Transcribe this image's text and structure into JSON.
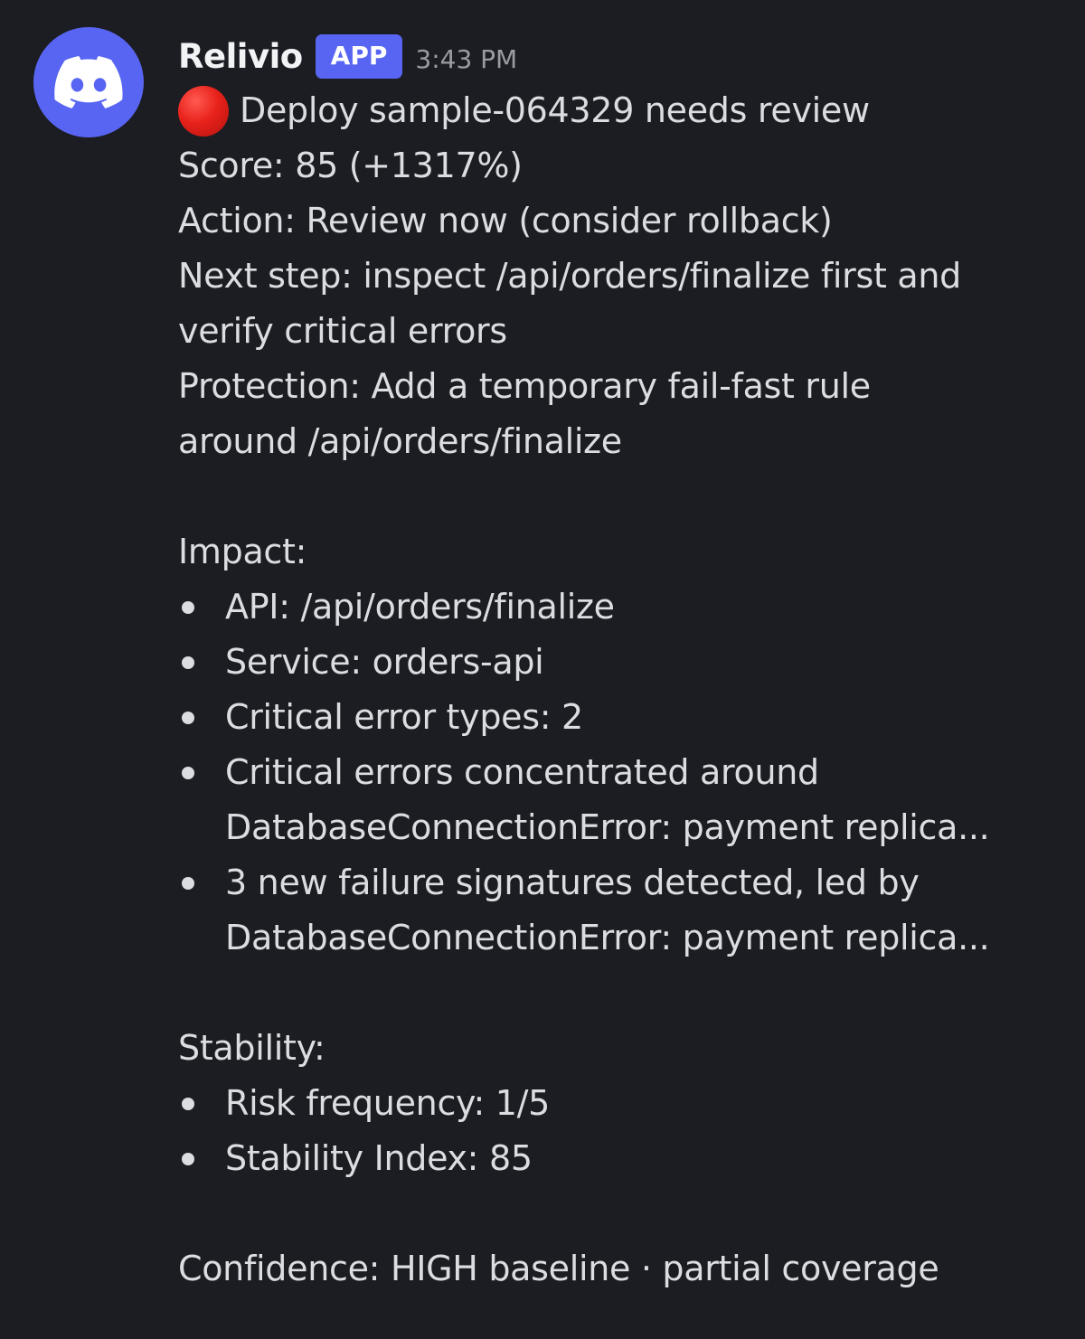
{
  "message": {
    "author": "Relivio",
    "badge": "APP",
    "timestamp": "3:43 PM",
    "avatar_icon": "discord-logo-icon",
    "status_icon": "red-circle-icon",
    "colors": {
      "background": "#1c1d22",
      "avatar_bg": "#5865f2",
      "badge_bg": "#5865f2",
      "status_red": "#e8221b"
    },
    "title": "Deploy sample-064329 needs review",
    "score": "Score: 85 (+1317%)",
    "action": "Action: Review now (consider rollback)",
    "next_step_1": "Next step: inspect /api/orders/finalize first and",
    "next_step_2": "verify critical errors",
    "protection_1": "Protection: Add a temporary fail-fast rule",
    "protection_2": "around /api/orders/finalize",
    "impact": {
      "heading": "Impact:",
      "items": [
        "API: /api/orders/finalize",
        "Service: orders-api",
        "Critical error types: 2",
        "Critical errors concentrated around",
        "3 new failure signatures detected, led by"
      ],
      "item_3_cont": "DatabaseConnectionError: payment replica...",
      "item_4_cont": "DatabaseConnectionError: payment replica..."
    },
    "stability": {
      "heading": "Stability:",
      "items": [
        "Risk frequency: 1/5",
        "Stability Index: 85"
      ]
    },
    "confidence": "Confidence: HIGH baseline · partial coverage"
  }
}
